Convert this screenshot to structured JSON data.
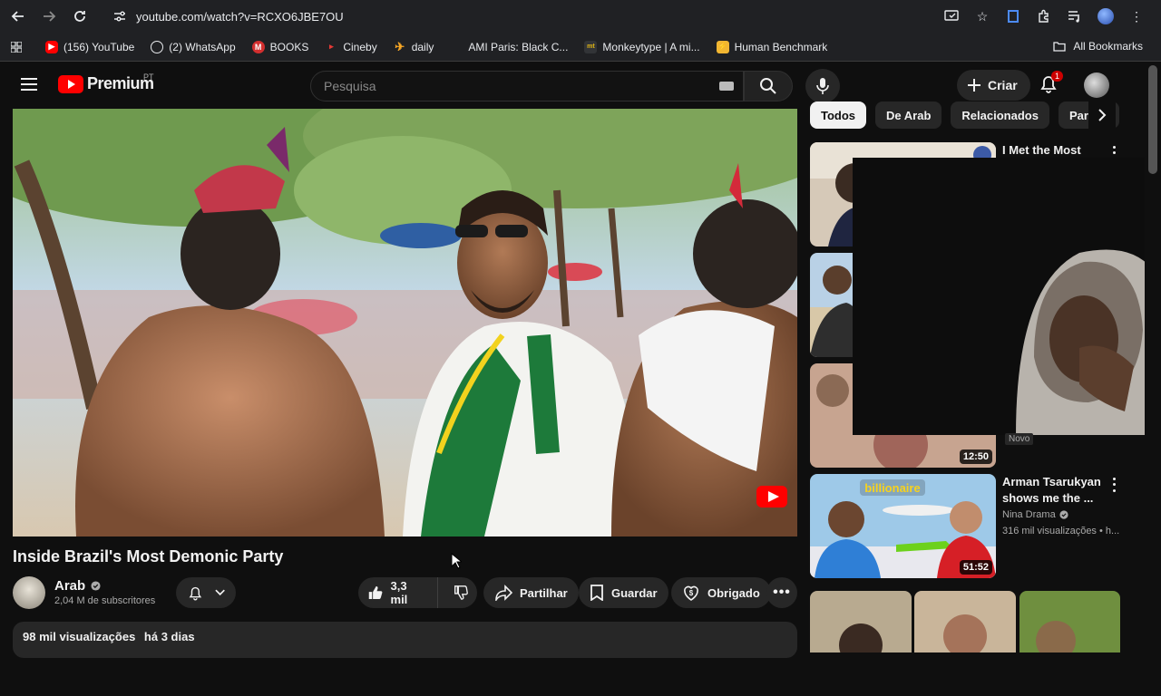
{
  "browser": {
    "url": "youtube.com/watch?v=RCXO6JBE7OU",
    "bookmarks": [
      {
        "label": "(156) YouTube",
        "icon": "youtube-icon",
        "color": "#ff0000"
      },
      {
        "label": "(2) WhatsApp",
        "icon": "whatsapp-icon",
        "color": "#25d366"
      },
      {
        "label": "BOOKS",
        "icon": "books-icon",
        "color": "#d32f2f"
      },
      {
        "label": "Cineby",
        "icon": "cineby-icon",
        "color": "#e53935"
      },
      {
        "label": "daily",
        "icon": "plane-icon",
        "color": "#f9a825"
      },
      {
        "label": "AMI Paris: Black C...",
        "icon": "ami-icon",
        "color": "#202124"
      },
      {
        "label": "Monkeytype | A mi...",
        "icon": "monkeytype-icon",
        "color": "#323437"
      },
      {
        "label": "Human Benchmark",
        "icon": "lightning-icon",
        "color": "#f2b632"
      }
    ],
    "all_bookmarks_label": "All Bookmarks"
  },
  "header": {
    "brand": "Premium",
    "country": "PT",
    "search_placeholder": "Pesquisa",
    "create_label": "Criar",
    "notification_count": "1"
  },
  "video": {
    "title": "Inside Brazil's Most Demonic Party",
    "channel": "Arab",
    "subscribers": "2,04 M de subscritores",
    "likes": "3,3 mil",
    "share_label": "Partilhar",
    "save_label": "Guardar",
    "thanks_label": "Obrigado",
    "views": "98 mil visualizações",
    "published": "há 3 dias"
  },
  "sidebar": {
    "chips": [
      "Todos",
      "De Arab",
      "Relacionados",
      "Para si"
    ],
    "recommendations": [
      {
        "title": "I Met the Most",
        "channel": "",
        "meta": "",
        "duration": ""
      },
      {
        "title": "",
        "channel": "",
        "meta": "",
        "duration": ""
      },
      {
        "title": "",
        "channel": "",
        "meta": "",
        "duration": "12:50",
        "badge": "Novo"
      },
      {
        "title": "Arman Tsarukyan shows me the ...",
        "channel": "Nina Drama",
        "meta": "316 mil visualizações • h...",
        "duration": "51:52"
      }
    ]
  },
  "colors": {
    "accent": "#ff0000",
    "background": "#0f0f0f",
    "surface": "#272727"
  }
}
